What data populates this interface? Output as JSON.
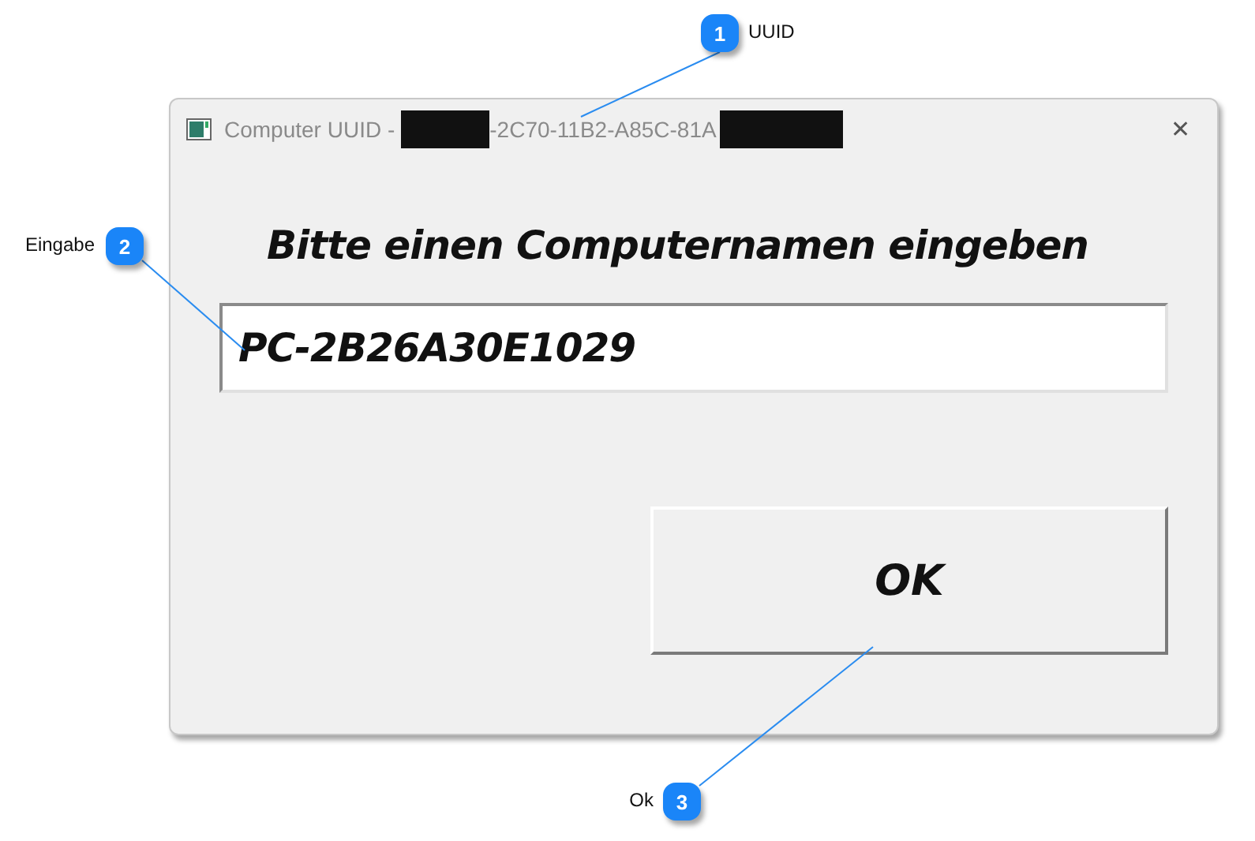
{
  "window": {
    "title": "Computer UUID -",
    "title_visible_part": "-2C70-11B2-A85C-81A",
    "close": "✕"
  },
  "dialog": {
    "prompt": "Bitte einen Computernamen eingeben",
    "input_value": "PC-2B26A30E1029",
    "button": "OK"
  },
  "callouts": [
    {
      "number": "1",
      "label": "UUID"
    },
    {
      "number": "2",
      "label": "Eingabe"
    },
    {
      "number": "3",
      "label": "Ok"
    }
  ]
}
